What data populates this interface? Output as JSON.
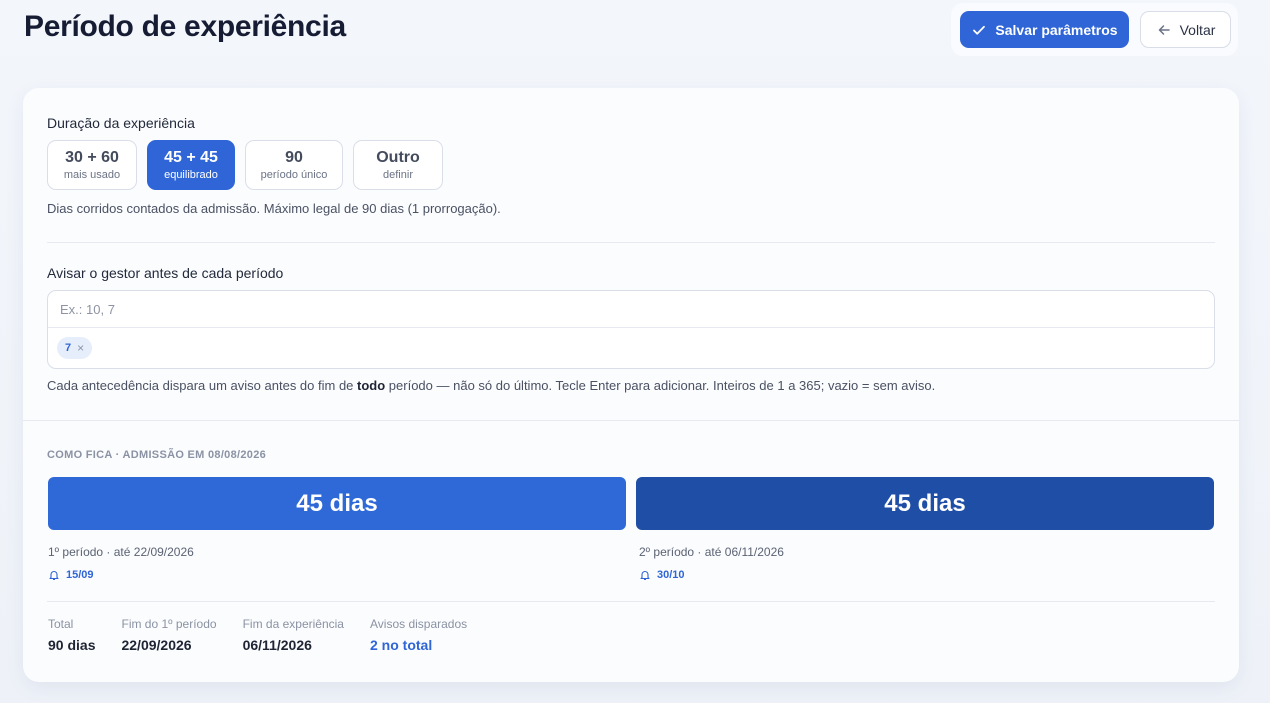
{
  "header": {
    "title": "Período de experiência",
    "save_label": "Salvar parâmetros",
    "back_label": "Voltar"
  },
  "duration": {
    "label": "Duração da experiência",
    "options": [
      {
        "value": "30 + 60",
        "desc": "mais usado",
        "selected": false
      },
      {
        "value": "45 + 45",
        "desc": "equilibrado",
        "selected": true
      },
      {
        "value": "90",
        "desc": "período único",
        "selected": false
      },
      {
        "value": "Outro",
        "desc": "definir",
        "selected": false
      }
    ],
    "hint": "Dias corridos contados da admissão. Máximo legal de 90 dias (1 prorrogação)."
  },
  "notify": {
    "label": "Avisar o gestor antes de cada período",
    "placeholder": "Ex.: 10, 7",
    "tags": [
      "7"
    ],
    "hint_before": "Cada antecedência dispara um aviso antes do fim de ",
    "hint_bold": "todo",
    "hint_after": " período — não só do último. Tecle Enter para adicionar. Inteiros de 1 a 365; vazio = sem aviso."
  },
  "preview": {
    "caption": "COMO FICA · ADMISSÃO EM 08/08/2026",
    "periods": [
      {
        "bar_label": "45 dias",
        "meta": "1º período · até 22/09/2026",
        "alert": "15/09"
      },
      {
        "bar_label": "45 dias",
        "meta": "2º período · até 06/11/2026",
        "alert": "30/10"
      }
    ],
    "summary": [
      {
        "key": "Total",
        "value": "90 dias"
      },
      {
        "key": "Fim do 1º período",
        "value": "22/09/2026"
      },
      {
        "key": "Fim da experiência",
        "value": "06/11/2026"
      },
      {
        "key": "Avisos disparados",
        "value": "2 no total"
      }
    ]
  },
  "colors": {
    "accent": "#2f65d6",
    "period2": "#1f4ea7"
  }
}
